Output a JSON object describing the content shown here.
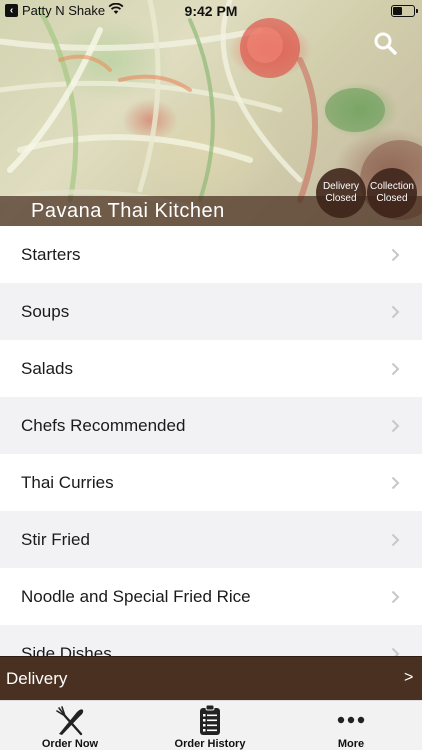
{
  "status_bar": {
    "back_app": "Patty N Shake",
    "time": "9:42 PM"
  },
  "header": {
    "restaurant_name": "Pavana Thai Kitchen",
    "delivery_status": {
      "line1": "Delivery",
      "line2": "Closed"
    },
    "collection_status": {
      "line1": "Collection",
      "line2": "Closed"
    },
    "search_icon": "search-icon"
  },
  "menu": {
    "items": [
      {
        "label": "Starters"
      },
      {
        "label": "Soups"
      },
      {
        "label": "Salads"
      },
      {
        "label": "Chefs Recommended"
      },
      {
        "label": "Thai Curries"
      },
      {
        "label": "Stir Fried"
      },
      {
        "label": "Noodle and Special Fried Rice"
      },
      {
        "label": "Side Dishes"
      }
    ]
  },
  "delivery_bar": {
    "label": "Delivery",
    "arrow": ">"
  },
  "tabs": [
    {
      "label": "Order Now",
      "icon": "fork-knife-icon"
    },
    {
      "label": "Order History",
      "icon": "clipboard-list-icon"
    },
    {
      "label": "More",
      "icon": "more-dots-icon"
    }
  ],
  "colors": {
    "brand_brown": "#4a3020",
    "overlay_brown": "#462d1e",
    "list_alt_row": "#f2f2f4"
  }
}
